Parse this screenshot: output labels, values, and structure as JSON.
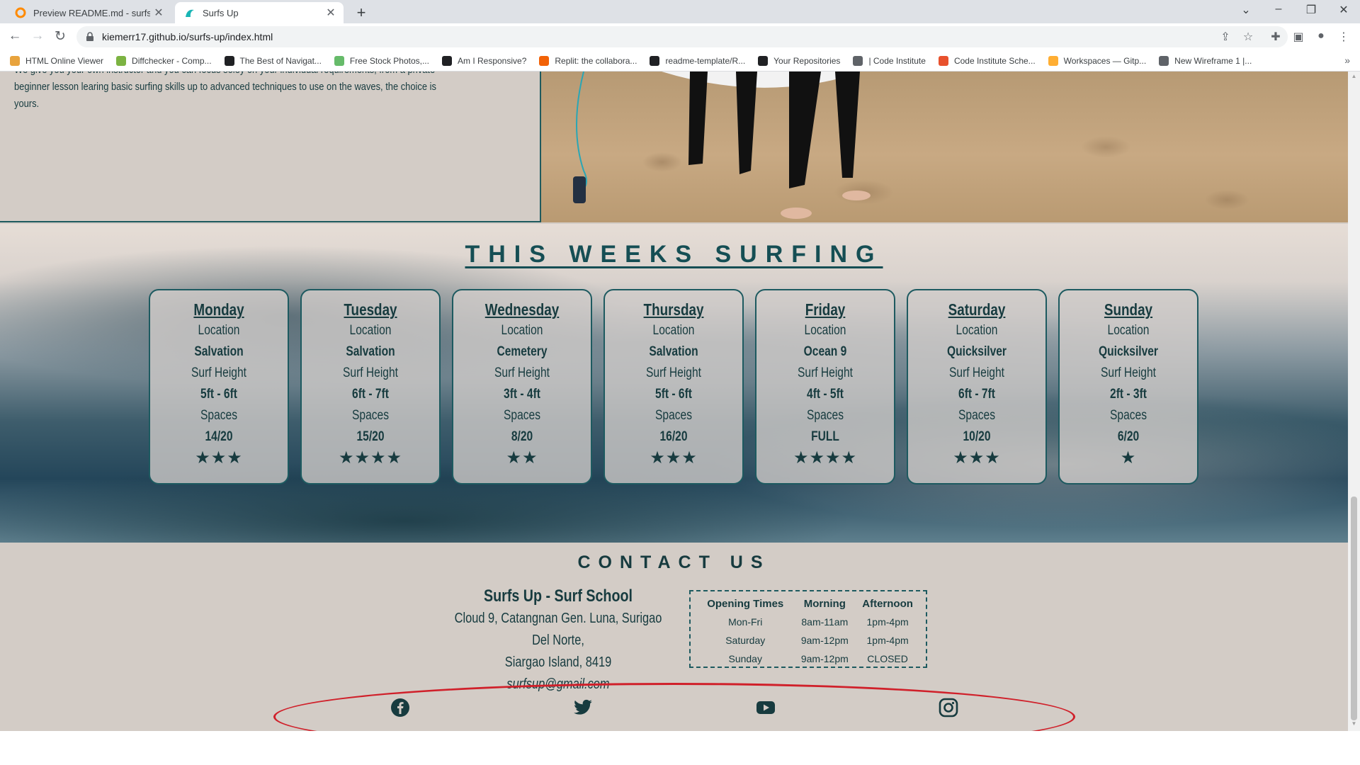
{
  "browser": {
    "tabs": [
      {
        "title": "Preview README.md - surfs-up",
        "active": false
      },
      {
        "title": "Surfs Up",
        "active": true
      }
    ],
    "new_tab": "+",
    "url": "kiemerr17.github.io/surfs-up/index.html",
    "bookmarks": [
      {
        "label": "HTML Online Viewer",
        "icon_color": "#e8a33d"
      },
      {
        "label": "Diffchecker - Comp...",
        "icon_color": "#7cb342"
      },
      {
        "label": "The Best of Navigat...",
        "icon_color": "#202124"
      },
      {
        "label": "Free Stock Photos,...",
        "icon_color": "#66bb6a"
      },
      {
        "label": "Am I Responsive?",
        "icon_color": "#202124"
      },
      {
        "label": "Replit: the collabora...",
        "icon_color": "#f26207"
      },
      {
        "label": "readme-template/R...",
        "icon_color": "#202124"
      },
      {
        "label": "Your Repositories",
        "icon_color": "#202124"
      },
      {
        "label": "| Code Institute",
        "icon_color": "#5f6368"
      },
      {
        "label": "Code Institute Sche...",
        "icon_color": "#e8512d"
      },
      {
        "label": "Workspaces — Gitp...",
        "icon_color": "#ffae33"
      },
      {
        "label": "New Wireframe 1 |...",
        "icon_color": "#5f6368"
      }
    ],
    "bookmarks_more": "»"
  },
  "about": {
    "text": "We give you your own instructor and you can focus soley on your individual requirements, from a private beginner lesson learing basic surfing skills up to advanced techniques to use on the waves, the choice is yours."
  },
  "schedule": {
    "title": "THIS WEEKS SURFING",
    "location_label": "Location",
    "height_label": "Surf Height",
    "spaces_label": "Spaces",
    "days": [
      {
        "day": "Monday",
        "location": "Salvation",
        "height": "5ft - 6ft",
        "spaces": "14/20",
        "stars": 3
      },
      {
        "day": "Tuesday",
        "location": "Salvation",
        "height": "6ft - 7ft",
        "spaces": "15/20",
        "stars": 4
      },
      {
        "day": "Wednesday",
        "location": "Cemetery",
        "height": "3ft - 4ft",
        "spaces": "8/20",
        "stars": 2
      },
      {
        "day": "Thursday",
        "location": "Salvation",
        "height": "5ft - 6ft",
        "spaces": "16/20",
        "stars": 3
      },
      {
        "day": "Friday",
        "location": "Ocean 9",
        "height": "4ft - 5ft",
        "spaces": "FULL",
        "stars": 4
      },
      {
        "day": "Saturday",
        "location": "Quicksilver",
        "height": "6ft - 7ft",
        "spaces": "10/20",
        "stars": 3
      },
      {
        "day": "Sunday",
        "location": "Quicksilver",
        "height": "2ft - 3ft",
        "spaces": "6/20",
        "stars": 1
      }
    ]
  },
  "contact": {
    "title": "CONTACT US",
    "school_name": "Surfs Up - Surf School",
    "address_line1": "Cloud 9, Catangnan Gen. Luna, Surigao Del Norte,",
    "address_line2": "Siargao Island, 8419",
    "email": "surfsup@gmail.com",
    "hours": {
      "headers": [
        "Opening Times",
        "Morning",
        "Afternoon"
      ],
      "rows": [
        [
          "Mon-Fri",
          "8am-11am",
          "1pm-4pm"
        ],
        [
          "Saturday",
          "9am-12pm",
          "1pm-4pm"
        ],
        [
          "Sunday",
          "9am-12pm",
          "CLOSED"
        ]
      ]
    },
    "socials": [
      "facebook-icon",
      "twitter-icon",
      "youtube-icon",
      "instagram-icon"
    ]
  },
  "colors": {
    "brand_teal": "#173b3f",
    "border_teal": "#1d5a60",
    "annotation_red": "#d0202a",
    "page_bg": "#d3ccc6"
  }
}
